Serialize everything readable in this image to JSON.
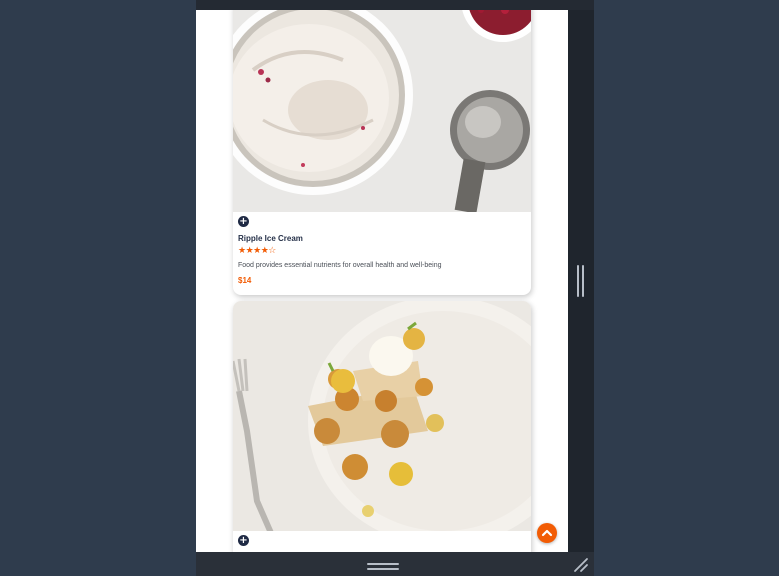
{
  "cards": [
    {
      "title": "Ripple Ice Cream",
      "stars": "★★★★☆",
      "rating": 4,
      "description": "Food provides essential nutrients for overall health and well-being",
      "price": "$14",
      "image": "ice-cream-bowl-photo"
    },
    {
      "image": "dessert-plate-photo"
    }
  ],
  "colors": {
    "accent": "#f25c05",
    "title": "#27324a",
    "background": "#2f3c4d"
  },
  "icons": [
    "plus-icon",
    "chevron-up-icon",
    "resize-grip-icon"
  ]
}
